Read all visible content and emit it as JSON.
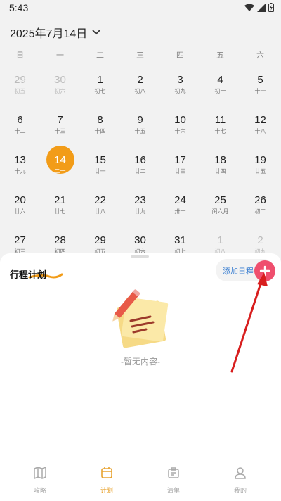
{
  "status": {
    "time": "5:43"
  },
  "calendar": {
    "title": "2025年7月14日",
    "weekdays": [
      "日",
      "一",
      "二",
      "三",
      "四",
      "五",
      "六"
    ],
    "weeks": [
      [
        {
          "n": "29",
          "l": "初五",
          "m": true
        },
        {
          "n": "30",
          "l": "初六",
          "m": true
        },
        {
          "n": "1",
          "l": "初七"
        },
        {
          "n": "2",
          "l": "初八"
        },
        {
          "n": "3",
          "l": "初九"
        },
        {
          "n": "4",
          "l": "初十"
        },
        {
          "n": "5",
          "l": "十一"
        }
      ],
      [
        {
          "n": "6",
          "l": "十二"
        },
        {
          "n": "7",
          "l": "十三"
        },
        {
          "n": "8",
          "l": "十四"
        },
        {
          "n": "9",
          "l": "十五"
        },
        {
          "n": "10",
          "l": "十六"
        },
        {
          "n": "11",
          "l": "十七"
        },
        {
          "n": "12",
          "l": "十八"
        }
      ],
      [
        {
          "n": "13",
          "l": "十九"
        },
        {
          "n": "14",
          "l": "二十",
          "t": true
        },
        {
          "n": "15",
          "l": "廿一"
        },
        {
          "n": "16",
          "l": "廿二"
        },
        {
          "n": "17",
          "l": "廿三"
        },
        {
          "n": "18",
          "l": "廿四"
        },
        {
          "n": "19",
          "l": "廿五"
        }
      ],
      [
        {
          "n": "20",
          "l": "廿六"
        },
        {
          "n": "21",
          "l": "廿七"
        },
        {
          "n": "22",
          "l": "廿八"
        },
        {
          "n": "23",
          "l": "廿九"
        },
        {
          "n": "24",
          "l": "卅十"
        },
        {
          "n": "25",
          "l": "闰六月"
        },
        {
          "n": "26",
          "l": "初二"
        }
      ],
      [
        {
          "n": "27",
          "l": "初三"
        },
        {
          "n": "28",
          "l": "初四"
        },
        {
          "n": "29",
          "l": "初五"
        },
        {
          "n": "30",
          "l": "初六"
        },
        {
          "n": "31",
          "l": "初七"
        },
        {
          "n": "1",
          "l": "初八",
          "m": true
        },
        {
          "n": "2",
          "l": "初九",
          "m": true
        }
      ]
    ]
  },
  "schedule": {
    "title": "行程计划",
    "add_label": "添加日程",
    "empty_text": "-暂无内容-"
  },
  "tabs": [
    {
      "label": "攻略",
      "icon": "map-icon"
    },
    {
      "label": "计划",
      "icon": "calendar-icon",
      "active": true
    },
    {
      "label": "清单",
      "icon": "checklist-icon"
    },
    {
      "label": "我的",
      "icon": "profile-icon"
    }
  ],
  "colors": {
    "accent": "#f29c18",
    "add_button": "#ef4f6e",
    "link": "#3b7fd1",
    "arrow": "#d81e1e"
  }
}
